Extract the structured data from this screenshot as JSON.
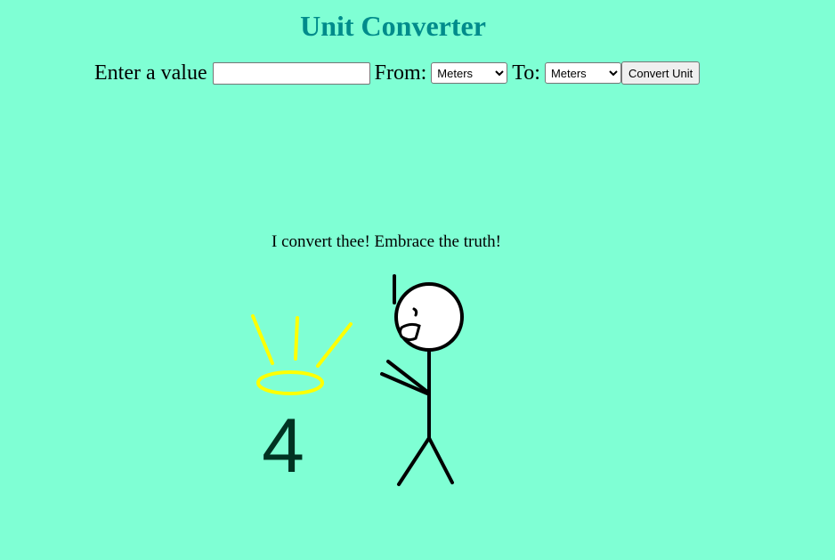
{
  "header": {
    "title": "Unit Converter"
  },
  "form": {
    "value_label": "Enter a value",
    "value_input": "",
    "from_label": "From:",
    "from_selected": "Meters",
    "to_label": "To:",
    "to_selected": "Meters",
    "convert_button_label": "Convert Unit"
  },
  "illustration": {
    "caption": "I convert thee! Embrace the truth!",
    "number": "4",
    "halo_color": "#ffff00",
    "number_color": "#003322",
    "figure_color": "#000000"
  },
  "colors": {
    "background": "#7fffd4",
    "title": "#008b8b"
  }
}
